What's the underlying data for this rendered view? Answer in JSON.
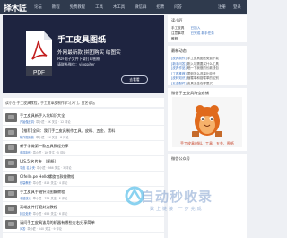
{
  "site": {
    "logo": "择木匠",
    "login": "注册",
    "register": "登录"
  },
  "nav": [
    "论坛",
    "教程",
    "免费教程",
    "工具",
    "木工具",
    "微信群",
    "招聘",
    "问答"
  ],
  "banner": {
    "title": "手工皮具图纸",
    "pdf_label": "PDF",
    "subtitle": "外网最新款 拼团购买 绘图实",
    "line1": "PDF电子文件下载打印图纸",
    "line2": "请联系微信：yingpiter",
    "button": "去看看"
  },
  "notice": "读小匠·手工皮具教程，手工皮革皮制作学习入门，皮艺论坛",
  "articles": [
    {
      "title": "手工皮具新手入坑知识大全",
      "meta_author": "开始做皮具",
      "meta": "· 章小匠 · 3K 关注 · 12 评论"
    },
    {
      "title": "【推荐]全网：我们手工皮具制作工具、皮料、五金、黑料",
      "meta_author": "制作提高篇",
      "meta": "· 章小匠 · 2K 关注 · 8 评论"
    },
    {
      "title": "新手学做第一款皮具教程分享",
      "meta_author": "皮具制作",
      "meta": "· 章小匠 · 1K 关注 · 5 评论"
    },
    {
      "title": "UIS.5 名片夹 （图纸）",
      "meta_author": "牛皮 名片夹",
      "meta": "· 章小匠 · 986 关注 · 3 评论"
    },
    {
      "title": "Olfelle.pe Hello螺旋包款做教程",
      "meta_author": "包袋教程",
      "meta": "· 章小匠 · 815 关注 · 4 评论"
    },
    {
      "title": "手工皮具手缝针法图解教程",
      "meta_author": "手缝技法",
      "meta": "· 章小匠 · 732 关注 · 2 评论"
    },
    {
      "title": "高端皮件打磨封边教程",
      "meta_author": "封边处理",
      "meta": "· 章小匠 · 655 关注 · 6 评论"
    },
    {
      "title": "请问手工皮具该用的机器有哪些左右分享简单",
      "meta_author": "问答",
      "meta": "· 章小匠 · 540 关注 · 9 评论"
    }
  ],
  "sidebar": {
    "reader": {
      "header": "读小匠",
      "rows": [
        {
          "a": "手工皮具",
          "b": "已加入"
        },
        {
          "a": "注意事项",
          "b": "已完成 新手任务"
        },
        {
          "a": "教程",
          "b": ""
        }
      ]
    },
    "latest": {
      "header": "最新动态",
      "items": [
        {
          "tag": "[皮具制作]",
          "text": " 手工皮具图纸免费下载"
        },
        {
          "tag": "[新手问答]",
          "text": " 刚入坑需要买什么工具"
        },
        {
          "tag": "[皮具作品]",
          "text": " 晒一下我做的长款钱包"
        },
        {
          "tag": "[工具推荐]",
          "text": " 菱斩怎么选择比较好"
        },
        {
          "tag": "[皮料知识]",
          "text": " 植鞣革和铬鞣革的区别"
        },
        {
          "tag": "[五金配件]",
          "text": " 皮具五金在哪里买"
        }
      ]
    },
    "shop": {
      "header": "微信手工皮具淘宝店铺",
      "caption": "手工皮具材料、工具、五金、图纸"
    },
    "wechat": {
      "header": "微信公众号"
    }
  },
  "watermark": {
    "big": "自动秒收录",
    "small": "数上链接 一步完成"
  }
}
